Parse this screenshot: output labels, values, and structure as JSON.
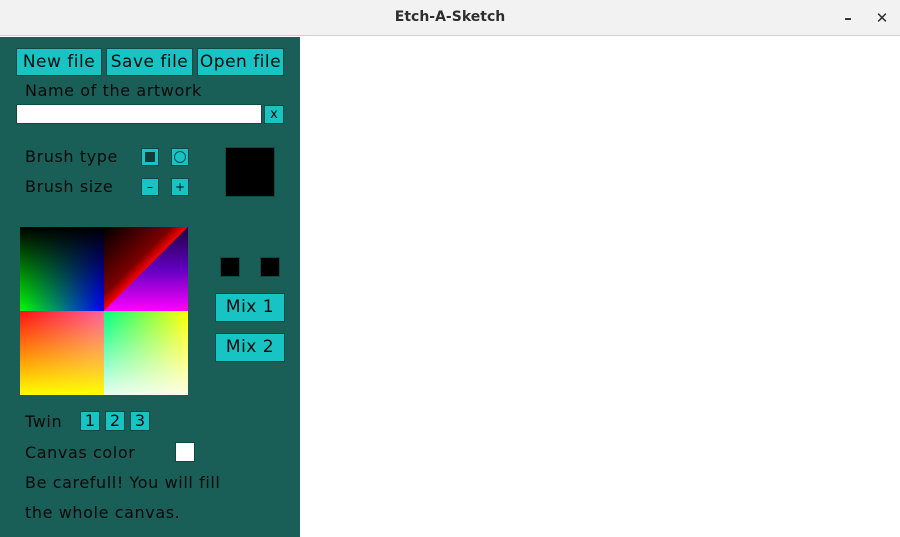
{
  "window": {
    "title": "Etch-A-Sketch",
    "minimize_label": "–",
    "close_label": "✕"
  },
  "toolbar": {
    "new_file": "New file",
    "save_file": "Save file",
    "open_file": "Open file"
  },
  "artwork": {
    "label": "Name of the artwork",
    "value": "",
    "clear_label": "x"
  },
  "brush": {
    "type_label": "Brush type",
    "size_label": "Brush size",
    "square_icon": "square-icon",
    "circle_icon": "circle-icon",
    "decrease_label": "–",
    "increase_label": "+",
    "current_color": "#000000"
  },
  "mix": {
    "swatch1_color": "#000000",
    "swatch2_color": "#000000",
    "mix1_label": "Mix 1",
    "mix2_label": "Mix 2"
  },
  "twin": {
    "label": "Twin",
    "options": [
      "1",
      "2",
      "3"
    ]
  },
  "canvas": {
    "color_label": "Canvas color",
    "color": "#ffffff",
    "warning_line1": "Be carefull! You will fill",
    "warning_line2": "the whole canvas."
  },
  "colors": {
    "panel_bg": "#1a5e58",
    "button_bg": "#17c3c3"
  }
}
